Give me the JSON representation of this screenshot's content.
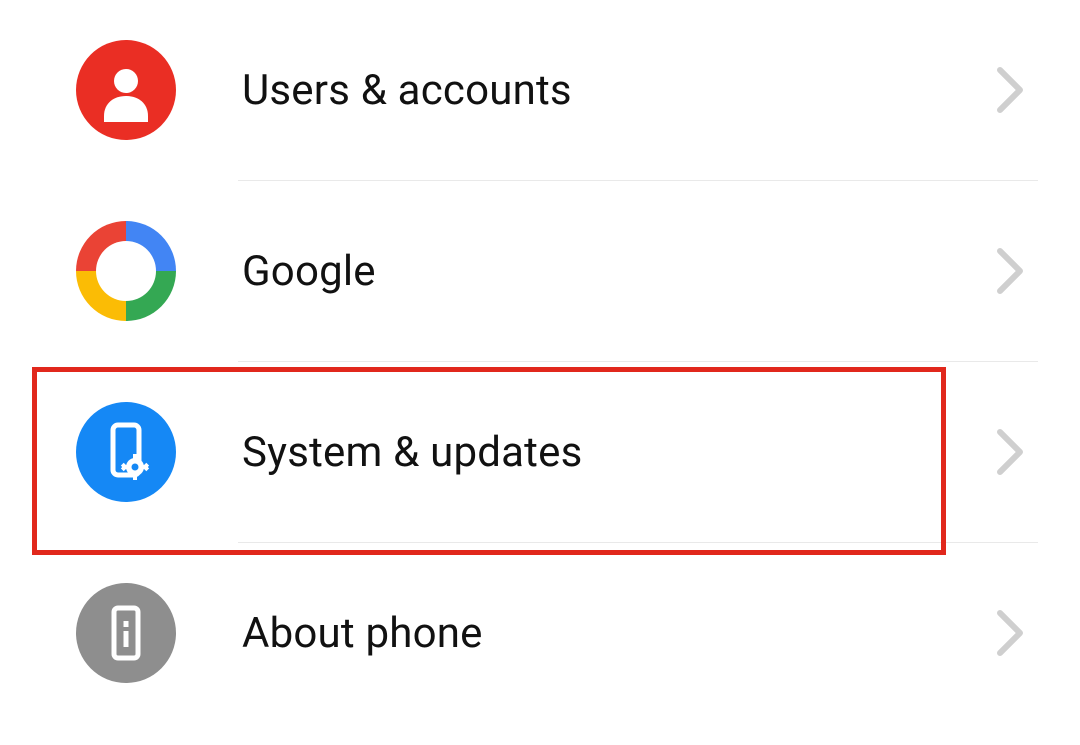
{
  "rows": [
    {
      "id": "users-accounts",
      "label": "Users & accounts",
      "icon": "person",
      "icon_bg": "#ea2e24"
    },
    {
      "id": "google",
      "label": "Google",
      "icon": "google",
      "icon_bg": null
    },
    {
      "id": "system-updates",
      "label": "System & updates",
      "icon": "phone-gear",
      "icon_bg": "#1588f5"
    },
    {
      "id": "about-phone",
      "label": "About phone",
      "icon": "phone-info",
      "icon_bg": "#8e8e8e"
    }
  ],
  "highlighted_row": "system-updates",
  "highlight_color": "#e1281c"
}
